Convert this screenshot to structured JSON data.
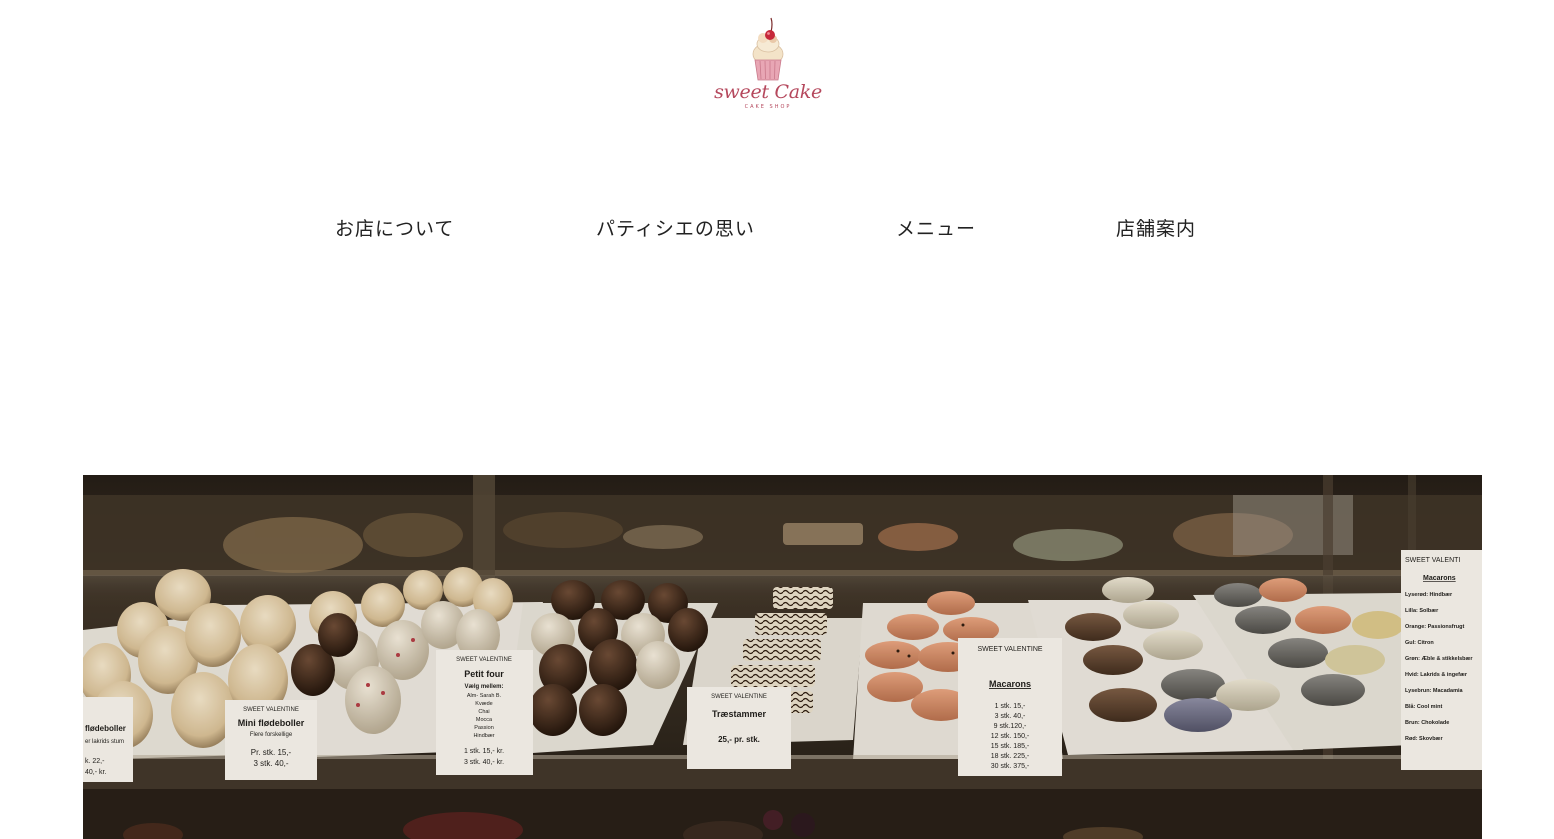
{
  "logo": {
    "title": "sweet Cake",
    "subtitle": "CAKE SHOP",
    "icon": "cupcake-icon",
    "color": "#b5485d"
  },
  "nav": {
    "items": [
      {
        "label": "お店について"
      },
      {
        "label": "パティシエの思い"
      },
      {
        "label": "メニュー"
      },
      {
        "label": "店舗案内"
      }
    ]
  },
  "hero": {
    "description_icon": "pastry-display-photo",
    "cards": {
      "mini": {
        "brand": "SWEET VALENTINE",
        "title": "Mini flødeboller",
        "sub": "Flere forskellige",
        "p1": "Pr. stk. 15,-",
        "p2": "3 stk. 40,-"
      },
      "left": {
        "l1": "flødeboller",
        "l2": "er lakrids stum",
        "p1": "k. 22,-",
        "p2": "40,- kr."
      },
      "petit": {
        "brand": "SWEET VALENTINE",
        "title": "Petit four",
        "l1": "Vælg mellem:",
        "l2": "Alm- Sarah B.",
        "l3": "Kvæde",
        "l4": "Chai",
        "l5": "Mocca",
        "l6": "Passion",
        "l7": "Hindbær",
        "p1": "1 stk. 15,- kr.",
        "p2": "3 stk. 40,- kr."
      },
      "trae": {
        "brand": "SWEET VALENTINE",
        "title": "Træstammer",
        "price": "25,- pr. stk."
      },
      "macarons": {
        "brand": "SWEET VALENTINE",
        "title": "Macarons",
        "p1": "1 stk. 15,-",
        "p2": "3 stk. 40,-",
        "p3": "9 stk.120,-",
        "p4": "12 stk. 150,-",
        "p5": "15 stk. 185,-",
        "p6": "18 stk. 225,-",
        "p7": "30 stk. 375,-"
      },
      "right": {
        "brand": "SWEET VALENTI",
        "title": "Macarons",
        "l1": "Lyserød: Hindbær",
        "l2": "Lilla: Solbær",
        "l3": "Orange: Passionsfrugt",
        "l4": "Gul: Citron",
        "l5": "Grøn: Æble & stikkelsbær",
        "l6": "Hvid: Lakrids & ingefær",
        "l7": "Lysebrun: Macadamia",
        "l8": "Blå: Cool mint",
        "l9": "Brun: Chokolade",
        "l10": "Rød: Skovbær"
      }
    }
  }
}
